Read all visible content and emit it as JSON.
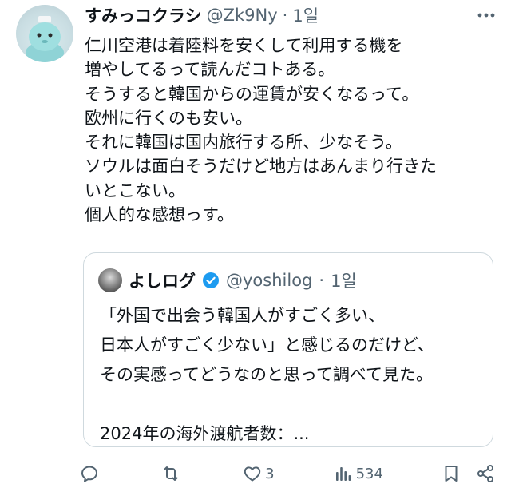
{
  "post": {
    "display_name": "すみっコクラシ",
    "handle": "@Zk9Ny",
    "separator": "·",
    "time": "1일",
    "body_lines": [
      "仁川空港は着陸料を安くして利用する機を",
      "増やしてるって読んだコトある。",
      "そうすると韓国からの運賃が安くなるって。",
      "欧州に行くのも安い。",
      "それに韓国は国内旅行する所、少なそう。",
      "ソウルは面白そうだけど地方はあんまり行きた",
      "いとこない。",
      "個人的な感想っす。"
    ]
  },
  "quote": {
    "display_name": "よしログ",
    "verified": true,
    "handle": "@yoshilog",
    "separator": "·",
    "time": "1일",
    "body_lines": [
      "「外国で出会う韓国人がすごく多い、",
      "日本人がすごく少ない」と感じるのだけど、",
      "その実感ってどうなのと思って調べて見た。",
      "",
      "2024年の海外渡航者数：..."
    ]
  },
  "actions": {
    "reply_count": "",
    "retweet_count": "",
    "like_count": "3",
    "views_count": "534"
  },
  "colors": {
    "text": "#0f1419",
    "muted": "#536471",
    "verified": "#1d9bf0",
    "border": "#cfd9de"
  },
  "icons": [
    "more-icon",
    "verified-badge-icon",
    "reply-icon",
    "retweet-icon",
    "like-icon",
    "views-icon",
    "bookmark-icon",
    "share-icon"
  ]
}
